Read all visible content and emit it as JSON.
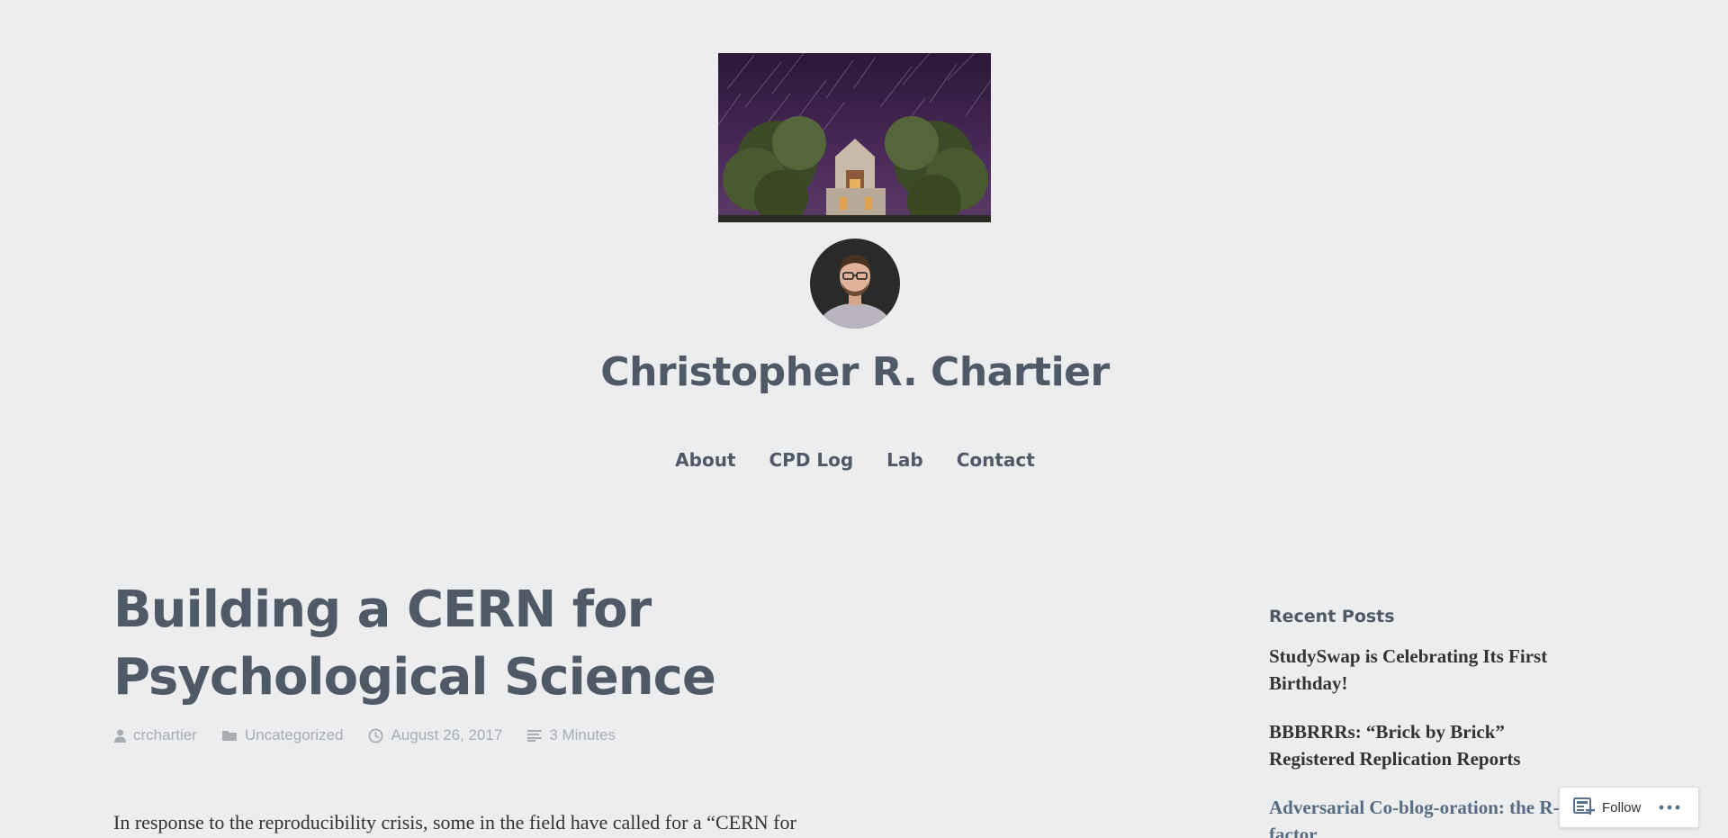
{
  "site": {
    "title": "Christopher R. Chartier"
  },
  "nav": {
    "items": [
      {
        "label": "About"
      },
      {
        "label": "CPD Log"
      },
      {
        "label": "Lab"
      },
      {
        "label": "Contact"
      }
    ]
  },
  "post": {
    "title": "Building a CERN for Psychological Science",
    "author": "crchartier",
    "category": "Uncategorized",
    "date": "August 26, 2017",
    "reading_time": "3 Minutes",
    "excerpt": "In response to the reproducibility crisis, some in the field have called for a “CERN for"
  },
  "sidebar": {
    "recent_posts_title": "Recent Posts",
    "recent_posts": [
      {
        "label": "StudySwap is Celebrating Its First Birthday!"
      },
      {
        "label": "BBBRRRs: “Brick by Brick” Registered Replication Reports"
      },
      {
        "label": "Adversarial Co-blog-oration: the R-factor"
      }
    ]
  },
  "follow_bar": {
    "follow_label": "Follow"
  },
  "icons": {
    "author": "person-icon",
    "category": "folder-icon",
    "date": "clock-icon",
    "reading_time": "lines-icon",
    "follow": "reader-icon",
    "more": "ellipsis-icon"
  },
  "colors": {
    "background": "#ecedef",
    "heading": "#4f5a66",
    "meta": "#a8adb3",
    "body_text": "#333333"
  }
}
